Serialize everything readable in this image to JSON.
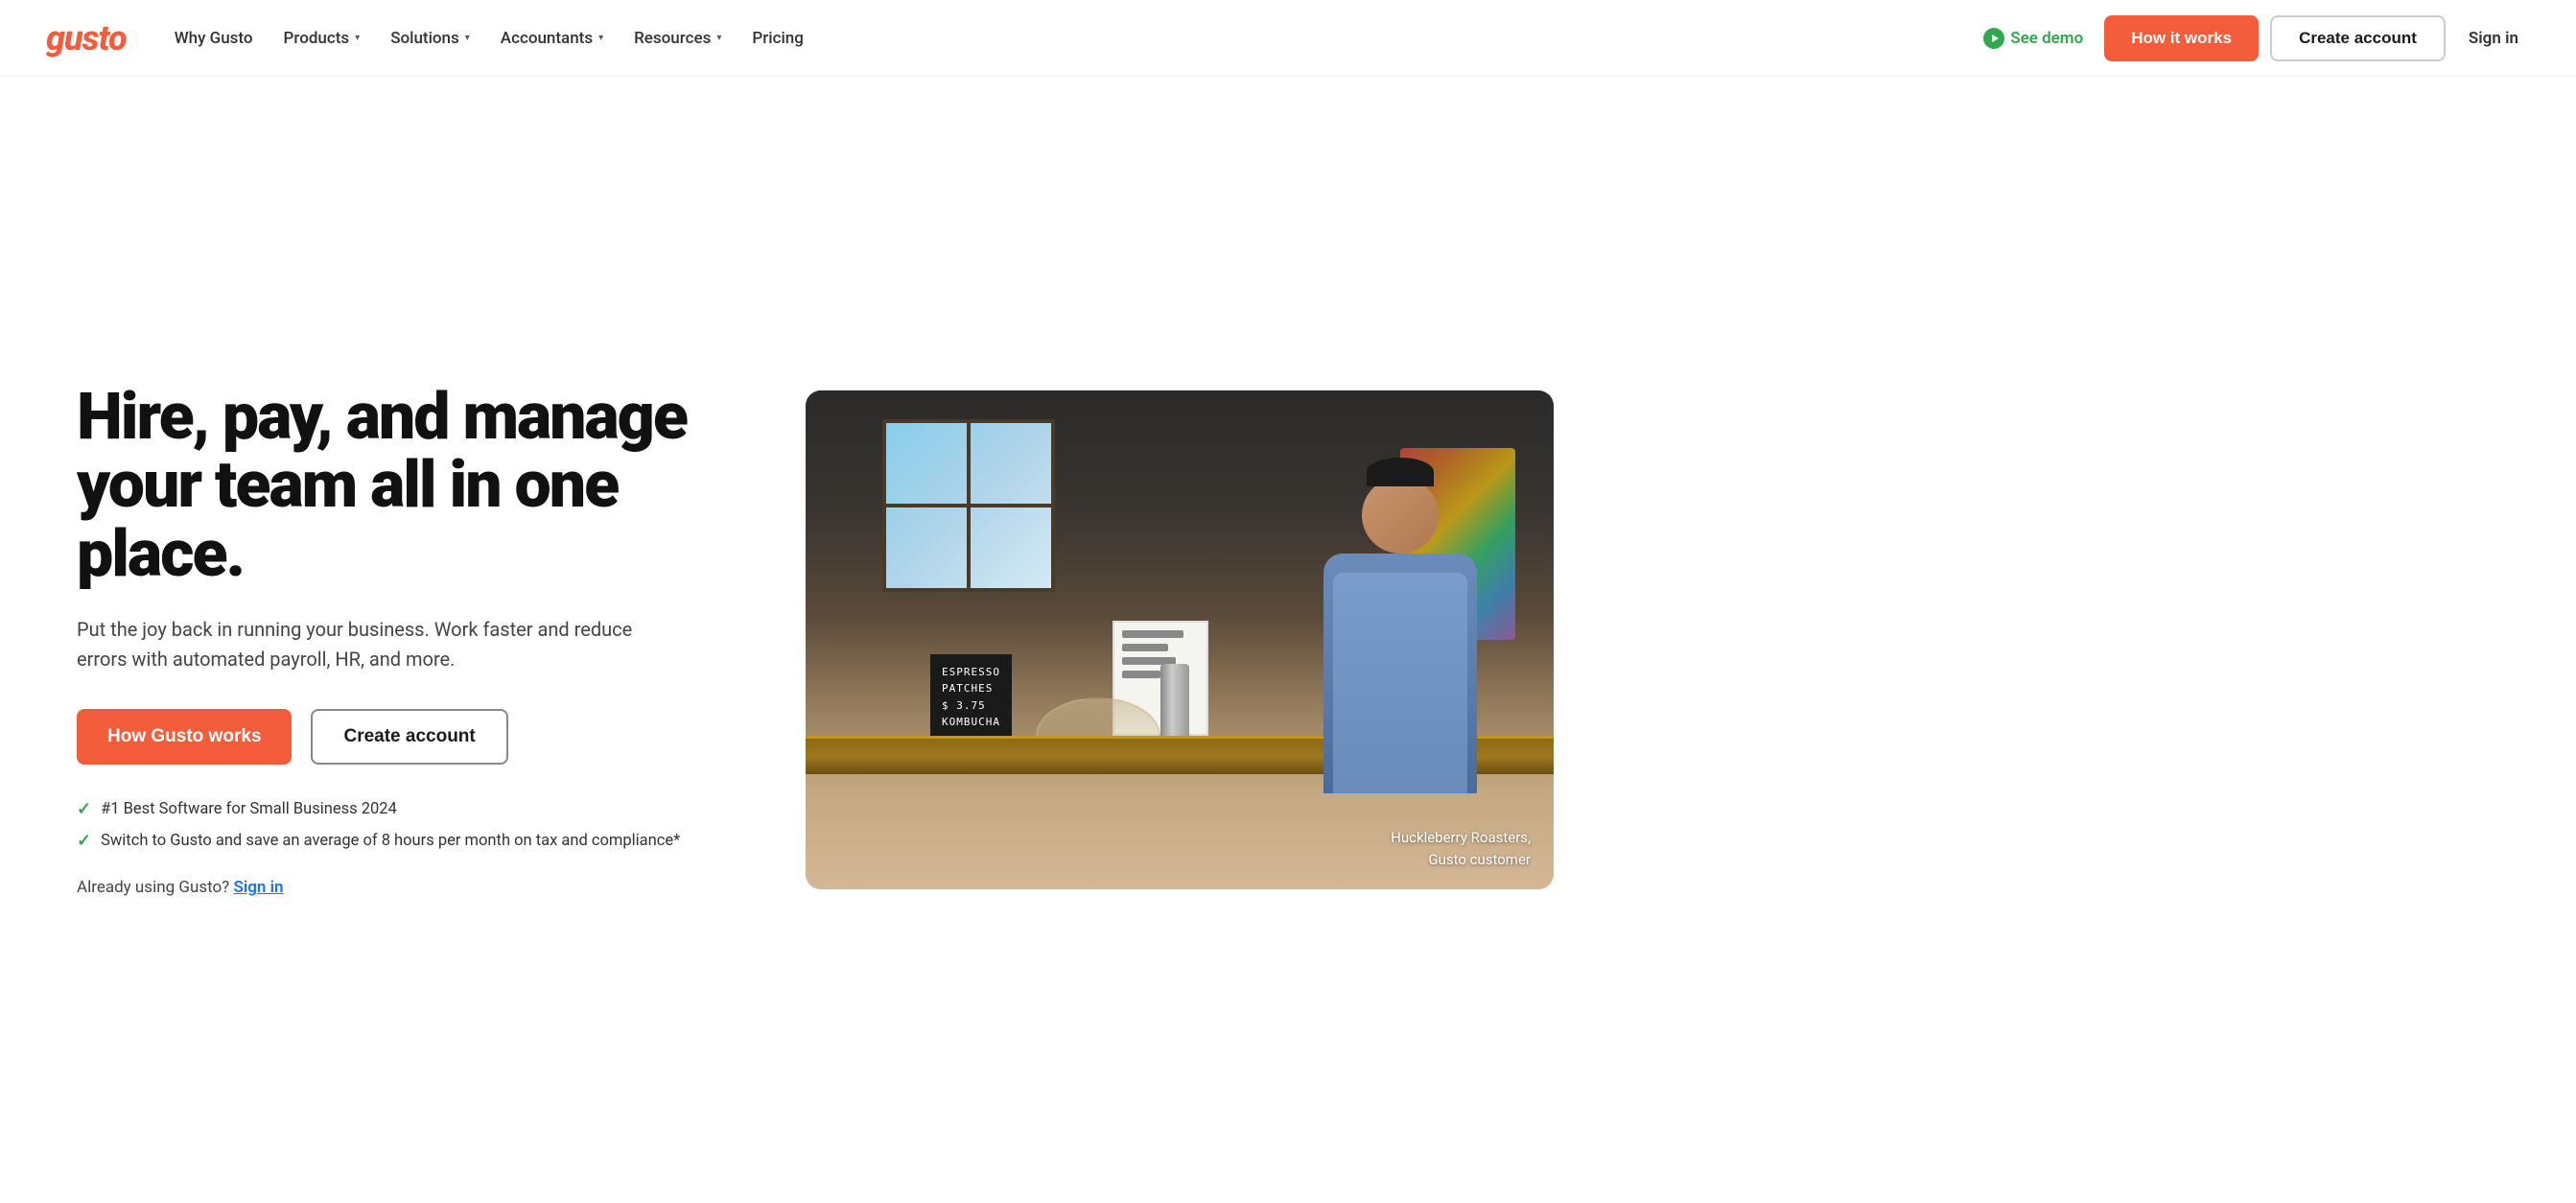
{
  "logo": {
    "text": "gusto"
  },
  "nav": {
    "items": [
      {
        "label": "Why Gusto",
        "hasDropdown": false
      },
      {
        "label": "Products",
        "hasDropdown": true
      },
      {
        "label": "Solutions",
        "hasDropdown": true
      },
      {
        "label": "Accountants",
        "hasDropdown": true
      },
      {
        "label": "Resources",
        "hasDropdown": true
      },
      {
        "label": "Pricing",
        "hasDropdown": false
      }
    ],
    "see_demo_label": "See demo",
    "how_it_works_label": "How it works",
    "create_account_label": "Create account",
    "sign_in_label": "Sign in"
  },
  "hero": {
    "title": "Hire, pay, and manage your team all in one place.",
    "subtitle": "Put the joy back in running your business. Work faster and reduce errors with automated payroll, HR, and more.",
    "cta_primary": "How Gusto works",
    "cta_secondary": "Create account",
    "trust_items": [
      "#1 Best Software for Small Business 2024",
      "Switch to Gusto and save an average of 8 hours per month on tax and compliance*"
    ],
    "already_using_text": "Already using Gusto?",
    "sign_in_link": "Sign in"
  },
  "image": {
    "caption_line1": "Huckleberry Roasters,",
    "caption_line2": "Gusto customer",
    "espresso_sign": "ESPRESSO\nPATCHES\n$ 3.75\nKOMBUCHA"
  },
  "colors": {
    "brand_orange": "#f45d3b",
    "brand_green": "#2fa84f",
    "text_dark": "#111111",
    "text_mid": "#444444"
  }
}
